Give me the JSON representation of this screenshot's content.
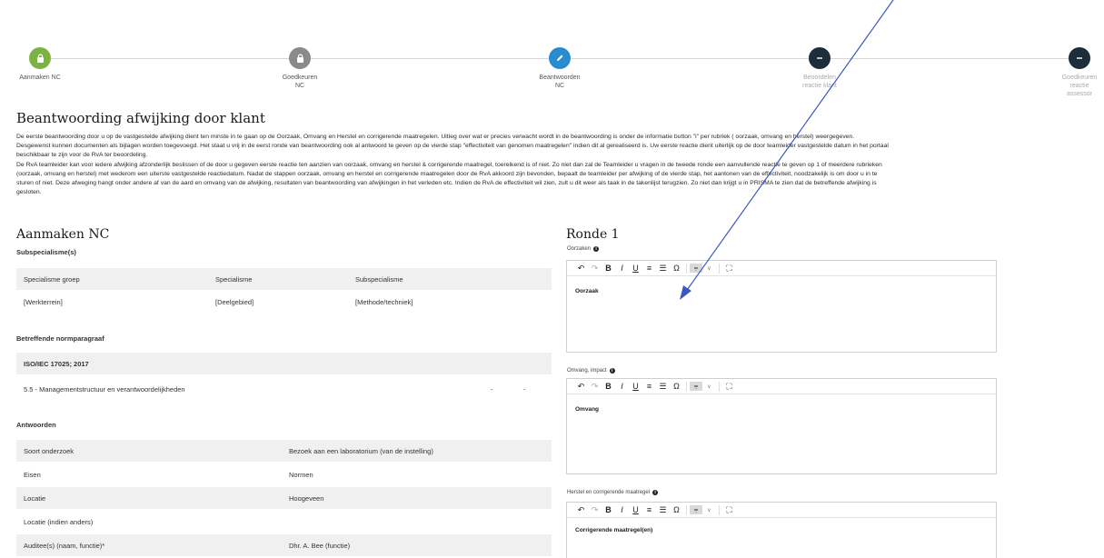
{
  "stepper": {
    "steps": [
      {
        "label": "Aanmaken NC",
        "icon": "lock-icon",
        "color": "#7bb342",
        "state": "done"
      },
      {
        "label": "Goedkeuren NC",
        "icon": "lock-icon",
        "color": "#8a8a8a",
        "state": "done"
      },
      {
        "label": "Beantwoorden NC",
        "icon": "pencil-icon",
        "color": "#2a8cd0",
        "state": "active"
      },
      {
        "label": "Beoordelen reactie klant",
        "icon": "minus-icon",
        "color": "#1d2d3c",
        "state": "todo"
      },
      {
        "label": "Goedkeuren reactie assessor",
        "icon": "minus-icon",
        "color": "#1d2d3c",
        "state": "todo"
      }
    ]
  },
  "intro": {
    "title": "Beantwoording afwijking door klant",
    "paragraph1": "De eerste beantwoording door u op de vastgestelde afwijking dient ten minste in te gaan op de Oorzaak, Omvang en Herstel en corrigerende maatregelen. Uitleg over wat er precies verwacht wordt in de beantwoording is onder de informatie button \"i\" per rubriek ( oorzaak, omvang en herstel) weergegeven. Desgewenst kunnen documenten als bijlagen worden toegevoegd. Het staat u vrij in de eerst ronde van beantwoording ook al antwoord te geven op de vierde stap \"effectiviteit van genomen maatregelen\" indien dit al gerealiseerd is. Uw eerste reactie dient uiterlijk op de door teamleider vastgestelde datum in het portaal beschikbaar te zijn voor de RvA ter beoordeling.",
    "paragraph2": "De RvA teamleider kan voor iedere afwijking afzonderlijk beslissen of de door u gegeven eerste reactie ten aanzien van oorzaak, omvang en herstel & corrigerende maatregel, toereikend is of niet. Zo niet dan zal de Teamleider u vragen in de tweede ronde een aanvullende reactie te geven op 1 of meerdere rubrieken (oorzaak, omvang en herstel) met wederom een uiterste vastgestelde reactiedatum. Nadat de stappen oorzaak, omvang en herstel en corrigerende maatregelen door de RvA akkoord zijn bevonden, bepaalt de teamleider per afwijking of de vierde stap, het aantonen van de effectiviteit, noodzakelijk is om door u in te sturen of niet. Deze afweging hangt onder andere af van de aard en omvang van de afwijking, resultaten van beantwoording van afwijkingen in het verleden etc. Indien de RvA de effectiviteit wil zien, zult u dit weer als taak in de takenlijst terugzien. Zo niet dan krijgt u in PRISMA te zien dat de betreffende afwijking is gesloten."
  },
  "left": {
    "heading": "Aanmaken NC",
    "subspecialisme_label": "Subspecialisme(s)",
    "spec_headers": [
      "Specialisme groep",
      "Specialisme",
      "Subspecialisme"
    ],
    "spec_row": [
      "[Werkterrein]",
      "[Deelgebied]",
      "[Methode/techniek]"
    ],
    "norm_label": "Betreffende normparagraaf",
    "norm_header": "ISO/IEC 17025; 2017",
    "norm_row": {
      "text": "5.5 - Managementstructuur en verantwoordelijkheden",
      "dash1": "-",
      "dash2": "-"
    },
    "answers_label": "Antwoorden",
    "answers": [
      {
        "key": "Soort onderzoek",
        "value": "Bezoek aan een laboratorium (van de instelling)"
      },
      {
        "key": "Eisen",
        "value": "Normen"
      },
      {
        "key": "Locatie",
        "value": "Hoogeveen"
      },
      {
        "key": "Locatie (indien anders)",
        "value": ""
      },
      {
        "key": "Auditee(s) (naam, functie)*",
        "value": "Dhr. A. Bee (functie)"
      }
    ]
  },
  "right": {
    "heading": "Ronde 1",
    "editors": [
      {
        "label": "Oorzaken",
        "content": "Oorzaak"
      },
      {
        "label": "Omvang, impact",
        "content": "Omvang"
      },
      {
        "label": "Herstel en corrigerende maatregel",
        "content": "Corrigerende maatregel(en)"
      }
    ],
    "toolbar_icons": [
      "undo-icon",
      "redo-icon",
      "bold-icon",
      "italic-icon",
      "underline-icon",
      "numbered-list-icon",
      "bullet-list-icon",
      "special-char-icon",
      "style-icon",
      "dropdown-icon",
      "fullscreen-icon"
    ]
  },
  "colors": {
    "annotation_arrow": "#3a57c4"
  }
}
